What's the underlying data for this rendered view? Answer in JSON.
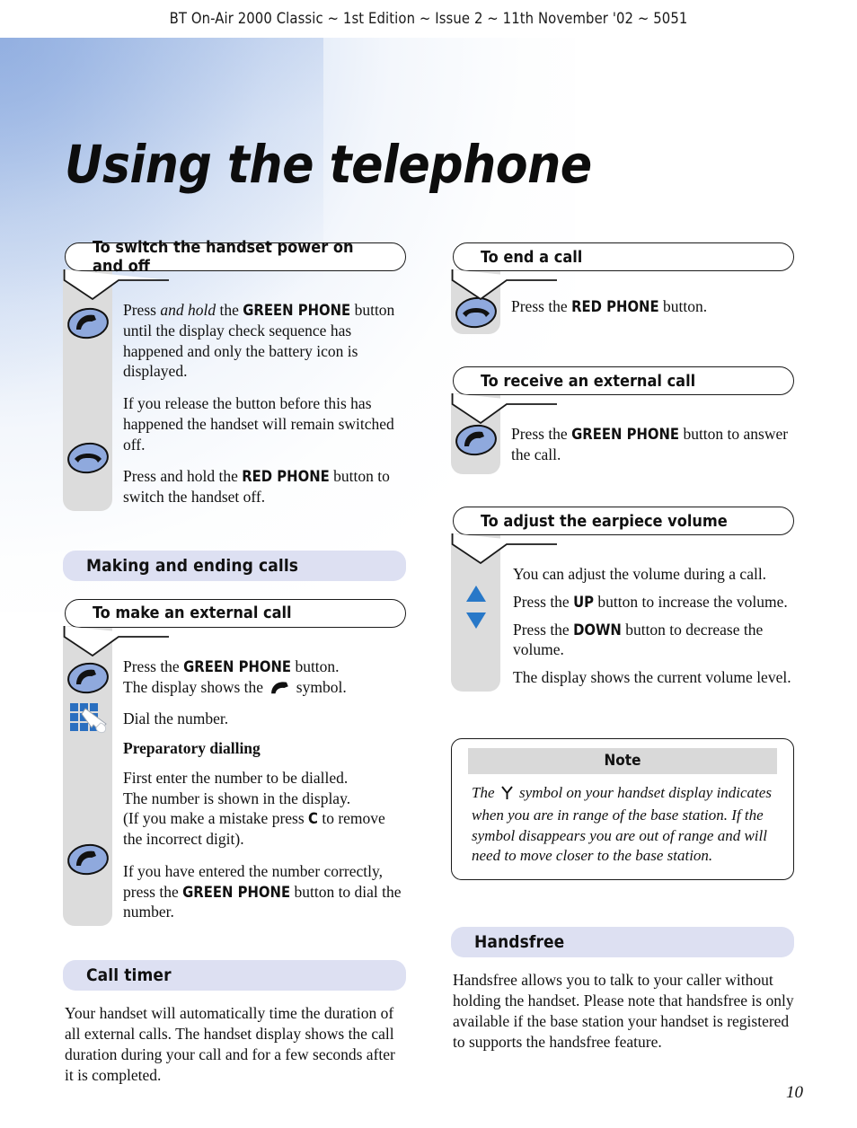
{
  "header": {
    "running_head": "BT On-Air 2000 Classic ~ 1st Edition ~ Issue 2 ~ 11th November '02 ~ 5051"
  },
  "title": "Using the telephone",
  "page_number": "10",
  "colors": {
    "band_lavender": "#dde0f2",
    "strip_grey": "#dcdcdc",
    "note_head_grey": "#d9d9d9",
    "icon_blue": "#8fa9dd",
    "keypad_blue": "#2a6fc0",
    "arrow_blue": "#2878c8",
    "corner_gradient_blue": "#a8bde4",
    "text_black": "#111111"
  },
  "left_column": {
    "callout_power": {
      "heading": "To switch the handset power on and off",
      "icons": [
        "green-phone-icon",
        "red-phone-icon"
      ],
      "paragraphs": [
        {
          "id": "p1",
          "runs": [
            {
              "t": "Press ",
              "s": "n"
            },
            {
              "t": "and hold",
              "s": "i"
            },
            {
              "t": " the ",
              "s": "n"
            },
            {
              "t": "GREEN PHONE",
              "s": "b"
            },
            {
              "t": " button until the display check sequence has happened and only the battery icon is displayed.",
              "s": "n"
            }
          ]
        },
        {
          "id": "p2",
          "runs": [
            {
              "t": "If you release the button before this has happened the handset will remain switched off.",
              "s": "n"
            }
          ]
        },
        {
          "id": "p3",
          "runs": [
            {
              "t": "Press and hold the ",
              "s": "n"
            },
            {
              "t": "RED PHONE",
              "s": "b"
            },
            {
              "t": " button to switch the handset off.",
              "s": "n"
            }
          ]
        }
      ]
    },
    "band_making": "Making and ending calls",
    "callout_external": {
      "heading": "To make an external call",
      "icons": [
        "green-phone-icon",
        "keypad-icon",
        "green-phone-icon"
      ],
      "paragraphs": [
        {
          "id": "p1",
          "runs": [
            {
              "t": "Press the ",
              "s": "n"
            },
            {
              "t": "GREEN PHONE",
              "s": "b"
            },
            {
              "t": " button.",
              "s": "n"
            },
            {
              "t": "BR",
              "s": "br"
            },
            {
              "t": "The display shows the ",
              "s": "n"
            },
            {
              "t": "HANDSET",
              "s": "sym"
            },
            {
              "t": " symbol.",
              "s": "n"
            }
          ]
        },
        {
          "id": "p2",
          "runs": [
            {
              "t": "Dial the number.",
              "s": "n"
            }
          ]
        },
        {
          "id": "p3",
          "runs": [
            {
              "t": "Preparatory dialling",
              "s": "b2"
            }
          ]
        },
        {
          "id": "p4",
          "runs": [
            {
              "t": "First enter the number to be dialled.",
              "s": "n"
            },
            {
              "t": "BR",
              "s": "br"
            },
            {
              "t": "The number is shown in the display.",
              "s": "n"
            },
            {
              "t": "BR",
              "s": "br"
            },
            {
              "t": "(If you make a mistake press ",
              "s": "n"
            },
            {
              "t": "C",
              "s": "b"
            },
            {
              "t": " to remove the incorrect digit).",
              "s": "n"
            }
          ]
        },
        {
          "id": "p5",
          "runs": [
            {
              "t": "If you have entered the number correctly, press the ",
              "s": "n"
            },
            {
              "t": "GREEN PHONE",
              "s": "b"
            },
            {
              "t": " button to dial the number.",
              "s": "n"
            }
          ]
        }
      ]
    },
    "band_call_timer": "Call timer",
    "call_timer_text": "Your handset will automatically time the duration of all external calls. The handset display shows the call duration during your call and for a few seconds after it is completed."
  },
  "right_column": {
    "callout_end": {
      "heading": "To end a call",
      "icons": [
        "red-phone-icon"
      ],
      "paragraphs": [
        {
          "id": "p1",
          "runs": [
            {
              "t": "Press the ",
              "s": "n"
            },
            {
              "t": "RED PHONE",
              "s": "b"
            },
            {
              "t": " button.",
              "s": "n"
            }
          ]
        }
      ]
    },
    "callout_receive": {
      "heading": "To receive an external call",
      "icons": [
        "green-phone-icon"
      ],
      "paragraphs": [
        {
          "id": "p1",
          "runs": [
            {
              "t": "Press the ",
              "s": "n"
            },
            {
              "t": "GREEN PHONE",
              "s": "b"
            },
            {
              "t": " button to answer the call.",
              "s": "n"
            }
          ]
        }
      ]
    },
    "callout_volume": {
      "heading": "To adjust the earpiece volume",
      "icons": [
        "up-arrow-icon",
        "down-arrow-icon"
      ],
      "paragraphs": [
        {
          "id": "p1",
          "runs": [
            {
              "t": "You can adjust the volume during a call.",
              "s": "n"
            }
          ]
        },
        {
          "id": "p2",
          "runs": [
            {
              "t": "Press the ",
              "s": "n"
            },
            {
              "t": "UP",
              "s": "b"
            },
            {
              "t": " button to increase the volume.",
              "s": "n"
            }
          ]
        },
        {
          "id": "p3",
          "runs": [
            {
              "t": "Press the ",
              "s": "n"
            },
            {
              "t": "DOWN",
              "s": "b"
            },
            {
              "t": " button to decrease the volume.",
              "s": "n"
            }
          ]
        },
        {
          "id": "p4",
          "runs": [
            {
              "t": "The display shows the current volume level.",
              "s": "n"
            }
          ]
        }
      ]
    },
    "note": {
      "heading": "Note",
      "runs": [
        {
          "t": "The ",
          "s": "n"
        },
        {
          "t": "ANTENNA",
          "s": "sym"
        },
        {
          "t": " symbol on your handset display indicates when you are in range of the base station. If the symbol disappears you are out of range and will need to move closer to the base station.",
          "s": "n"
        }
      ]
    },
    "band_handsfree": "Handsfree",
    "handsfree_text": "Handsfree allows you to talk to your caller without holding the handset. Please note that handsfree is only available if the base station your handset is registered to supports the handsfree feature."
  }
}
